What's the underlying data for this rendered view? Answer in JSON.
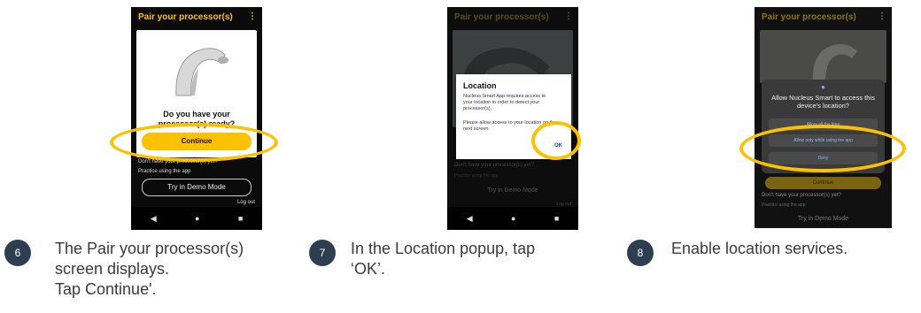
{
  "steps": [
    {
      "number": "6",
      "caption_lines": [
        "The Pair your processor(s)",
        "screen displays.",
        "Tap Continue'."
      ],
      "screen": {
        "title": "Pair your processor(s)",
        "question_line1": "Do you have your",
        "question_line2": "processor(s) ready?",
        "continue_label": "Continue",
        "demo_prompt": "Don't have your processor(s) yet?",
        "practice_text": "Practice using the app",
        "demo_button": "Try in Demo Mode",
        "logout_label": "Log out"
      }
    },
    {
      "number": "7",
      "caption_lines": [
        "In the Location popup, tap",
        "‘OK’."
      ],
      "screen": {
        "title": "Pair your processor(s)",
        "dialog_title": "Location",
        "dialog_body": "Nucleus Smart App requires access to your location in order to detect your processor(s).",
        "dialog_body2": "Please allow access to your location on the next screen.",
        "ok_label": "OK",
        "demo_prompt": "Don't have your processor(s) yet?",
        "practice_text": "Practice using the app",
        "demo_button": "Try in Demo Mode",
        "logout_label": "Log out"
      }
    },
    {
      "number": "8",
      "caption_lines": [
        "Enable location services."
      ],
      "screen": {
        "title": "Pair your processor(s)",
        "permission_question": "Allow Nucleus Smart to access this device's location?",
        "option_always": "Allow all the time",
        "option_while_using": "Allow only while using the app",
        "option_deny": "Deny",
        "continue_label": "Continue",
        "demo_prompt": "Don't have your processor(s) yet?",
        "practice_text": "Practice using the app",
        "demo_button": "Try in Demo Mode"
      }
    }
  ],
  "colors": {
    "accent": "#fcc100",
    "badge": "#2d3e50",
    "caption": "#3a3a3a"
  }
}
